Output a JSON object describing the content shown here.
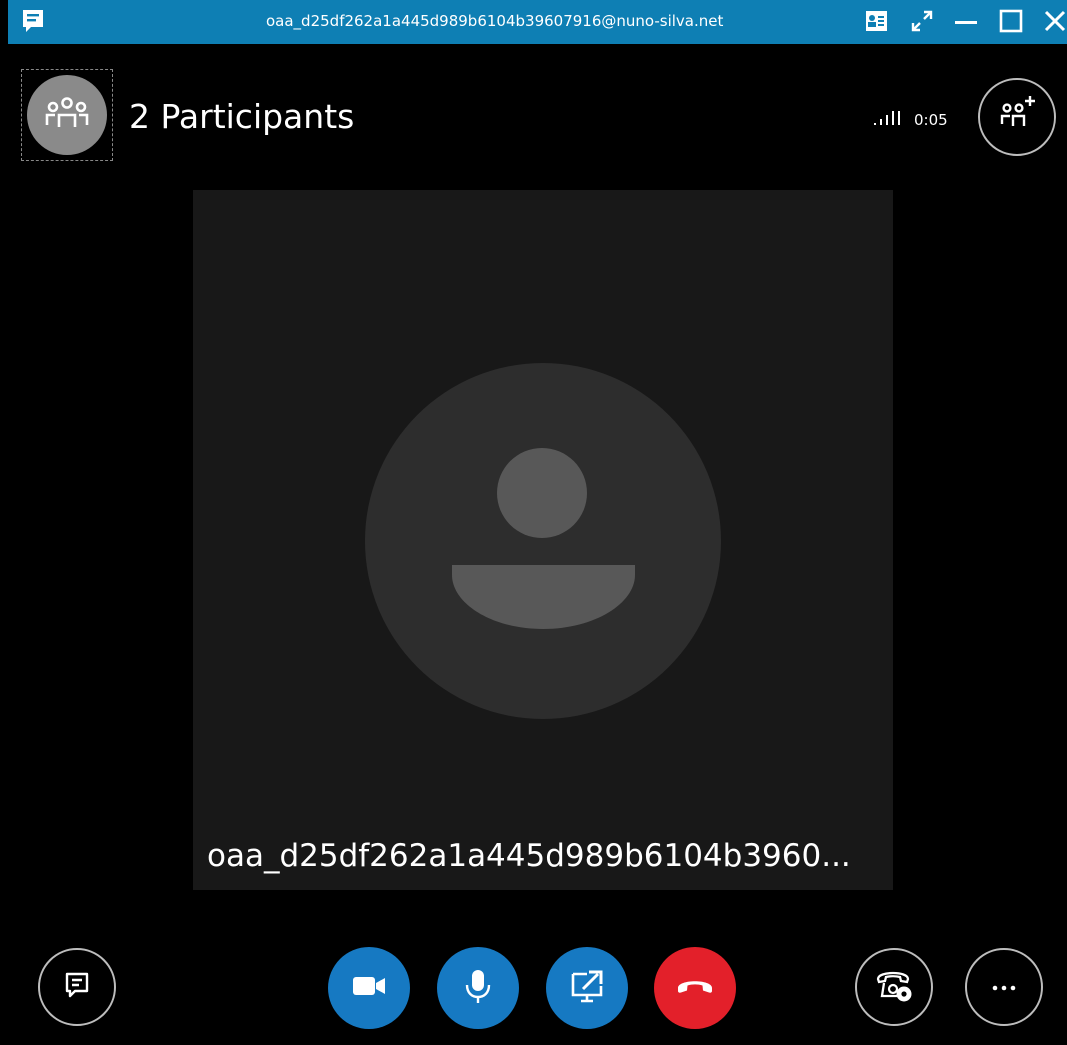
{
  "window": {
    "title": "oaa_d25df262a1a445d989b6104b39607916@nuno-silva.net"
  },
  "header": {
    "participants_label": "2 Participants",
    "call_timer": "0:05"
  },
  "video_tile": {
    "participant_name": "oaa_d25df262a1a445d989b6104b3960..."
  },
  "icons": {
    "app": "chat-icon",
    "contacts": "contacts-icon",
    "expand": "expand-icon",
    "minimize": "minimize-icon",
    "maximize": "maximize-icon",
    "close": "close-icon",
    "group": "group-icon",
    "signal": "signal-strength-icon",
    "add_people": "add-people-icon",
    "chat": "chat-icon",
    "video": "video-camera-icon",
    "mic": "microphone-icon",
    "share": "share-screen-icon",
    "hangup": "hang-up-icon",
    "call_controls": "call-controls-icon",
    "more": "more-options-icon"
  },
  "colors": {
    "titlebar": "#0e7fb4",
    "action_blue": "#1679c2",
    "hangup_red": "#e3202a",
    "tile_background": "#181818",
    "avatar_circle": "#2d2d2d",
    "avatar_figure": "#585858"
  }
}
